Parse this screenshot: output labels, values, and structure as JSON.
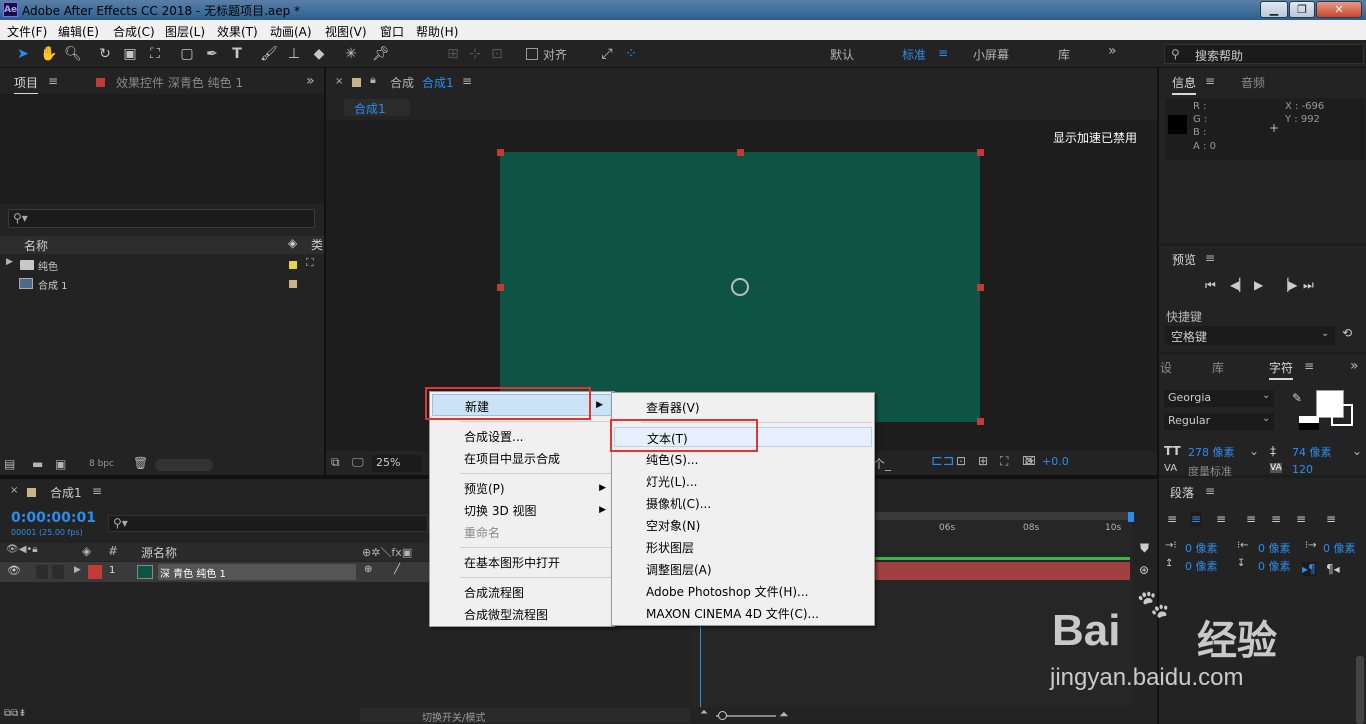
{
  "window": {
    "title": "Adobe After Effects CC 2018 - 无标题项目.aep *",
    "logo": "Ae"
  },
  "menubar": [
    "文件(F)",
    "编辑(E)",
    "合成(C)",
    "图层(L)",
    "效果(T)",
    "动画(A)",
    "视图(V)",
    "窗口",
    "帮助(H)"
  ],
  "toolbar": {
    "snap_label": "对齐",
    "workspaces": [
      "默认",
      "标准",
      "小屏幕",
      "库"
    ],
    "active_workspace": "标准",
    "more": "»",
    "search_placeholder": "搜索帮助"
  },
  "project_panel": {
    "tab_project": "项目",
    "tab_effects": "效果控件 深青色 纯色 1",
    "col_name": "名称",
    "items": [
      {
        "name": "纯色",
        "type": "folder"
      },
      {
        "name": "合成 1",
        "type": "composition"
      }
    ],
    "bpc": "8 bpc"
  },
  "viewer": {
    "tab_label": "合成",
    "tab_comp": "合成1",
    "breadcrumb": "合成1",
    "gpu_notice": "显示加速已禁用",
    "zoom": "25%",
    "exposure": "+0.0",
    "solid_color": "#0e5444"
  },
  "info_panel": {
    "tab_info": "信息",
    "tab_audio": "音频",
    "r": "R :",
    "g": "G :",
    "b": "B :",
    "a": "A : 0",
    "x": "X : -696",
    "y": "Y : 992"
  },
  "preview_panel": {
    "title": "预览",
    "shortcut_label": "快捷键",
    "shortcut_value": "空格键"
  },
  "character_panel": {
    "tabs": [
      "设",
      "库",
      "字符"
    ],
    "font": "Georgia",
    "style": "Regular",
    "size": "278 像素",
    "leading": "74 像素",
    "tracking": "度量标准",
    "kern": "120"
  },
  "paragraph_panel": {
    "title": "段落",
    "indent_left": "0 像素",
    "indent_right": "0 像素",
    "indent_first": "0 像素",
    "space_before": "0 像素",
    "space_after": "0 像素"
  },
  "timeline": {
    "tab": "合成1",
    "timecode": "0:00:00:01",
    "frame_info": "00001 (25.00 fps)",
    "col_source": "源名称",
    "layer_num": "1",
    "layer_name": "深 青色 纯色 1",
    "ruler": [
      "06s",
      "08s",
      "10s"
    ],
    "footer": "切换开关/模式"
  },
  "context_menu": {
    "items": [
      {
        "label": "新建",
        "submenu": true,
        "highlighted": true
      },
      {
        "label": "合成设置..."
      },
      {
        "label": "在项目中显示合成"
      },
      {
        "label": "预览(P)",
        "submenu": true
      },
      {
        "label": "切换 3D 视图",
        "submenu": true
      },
      {
        "label": "重命名",
        "disabled": true
      },
      {
        "label": "在基本图形中打开"
      },
      {
        "label": "合成流程图"
      },
      {
        "label": "合成微型流程图"
      }
    ]
  },
  "submenu": {
    "items": [
      "查看器(V)",
      "文本(T)",
      "纯色(S)...",
      "灯光(L)...",
      "摄像机(C)...",
      "空对象(N)",
      "形状图层",
      "调整图层(A)",
      "Adobe Photoshop 文件(H)...",
      "MAXON CINEMA 4D 文件(C)..."
    ]
  },
  "watermark": {
    "brand": "Bai",
    "brand_cn": "经验",
    "url": "jingyan.baidu.com"
  }
}
